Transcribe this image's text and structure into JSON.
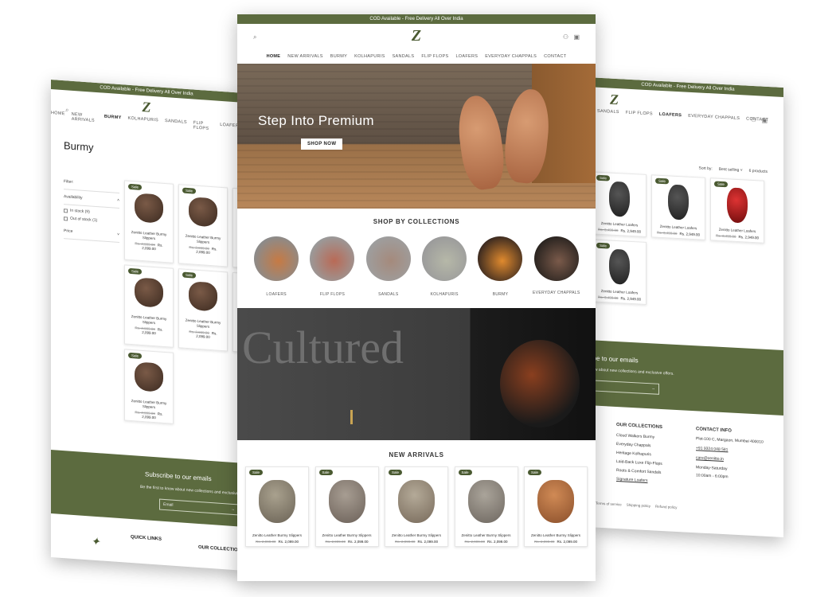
{
  "announcement": "COD Available - Free Delivery All Over India",
  "brand_letter": "Z",
  "nav": [
    "HOME",
    "NEW ARRIVALS",
    "BURMY",
    "KOLHAPURIS",
    "SANDALS",
    "FLIP FLOPS",
    "LOAFERS",
    "EVERYDAY CHAPPALS",
    "CONTACT"
  ],
  "left": {
    "nav": [
      "HOME",
      "NEW ARRIVALS",
      "BURMY",
      "KOLHAPURIS",
      "SANDALS",
      "FLIP FLOPS",
      "LOAFERS"
    ],
    "page_title": "Burmy",
    "filter_heading": "Filter:",
    "availability": "Availability",
    "in_stock": "In stock (9)",
    "out_of_stock": "Out of stock (1)",
    "price": "Price",
    "products": [
      {
        "badge": "Sale",
        "name": "Zenitto Leather Burmy Slippers",
        "old": "Rs. 2,999.00",
        "price": "Rs. 2,099.00"
      },
      {
        "badge": "Sale",
        "name": "Zenitto Leather Burmy Slippers",
        "old": "Rs. 2,999.00",
        "price": "Rs. 2,099.00"
      },
      {
        "badge": "Sale",
        "name": "Zenitto Leather Burmy Slippers",
        "old": "Rs. 2,999.00",
        "price": "Rs. 2,099.00"
      },
      {
        "badge": "Sale",
        "name": "Zenitto Leather Burmy Slippers",
        "old": "Rs. 2,999.00",
        "price": "Rs. 2,099.00"
      },
      {
        "badge": "Sale",
        "name": "Zenitto Leather Burmy Slippers",
        "old": "Rs. 2,999.00",
        "price": "Rs. 2,099.00"
      }
    ],
    "subscribe_title": "Subscribe to our emails",
    "subscribe_text": "Be the first to know about new collections and exclusive offers.",
    "email_placeholder": "Email",
    "quick_links": "QUICK LINKS",
    "our_collections": "OUR COLLECTIONS"
  },
  "center": {
    "hero_title": "Step Into Premium",
    "hero_button": "SHOP NOW",
    "collections_title": "SHOP BY COLLECTIONS",
    "collections": [
      "LOAFERS",
      "FLIP FLOPS",
      "SANDALS",
      "KOLHAPURIS",
      "BURMY",
      "EVERYDAY CHAPPALS"
    ],
    "banner_text": "Cultured",
    "arrivals_title": "NEW ARRIVALS",
    "arrivals": [
      {
        "badge": "Sale",
        "name": "Zenitto Leather Burmy Slippers",
        "old": "Rs. 2,999.00",
        "price": "Rs. 2,099.00"
      },
      {
        "badge": "Sale",
        "name": "Zenitto Leather Burmy Slippers",
        "old": "Rs. 2,999.00",
        "price": "Rs. 2,099.00"
      },
      {
        "badge": "Sale",
        "name": "Zenitto Leather Burmy Slippers",
        "old": "Rs. 2,999.00",
        "price": "Rs. 2,099.00"
      },
      {
        "badge": "Sale",
        "name": "Zenitto Leather Burmy Slippers",
        "old": "Rs. 2,999.00",
        "price": "Rs. 2,099.00"
      },
      {
        "badge": "Sale",
        "name": "Zenitto Leather Burmy Slippers",
        "old": "Rs. 2,999.00",
        "price": "Rs. 2,099.00"
      }
    ]
  },
  "right": {
    "nav": [
      "SANDALS",
      "FLIP FLOPS",
      "LOAFERS",
      "EVERYDAY CHAPPALS",
      "CONTACT"
    ],
    "sort_label": "Sort by:",
    "sort_value": "Best selling",
    "count": "6 products",
    "products": [
      {
        "badge": "Sale",
        "name": "Zenitto Leather Loafers",
        "old": "Rs. 3,499.00",
        "price": "Rs. 2,949.00"
      },
      {
        "badge": "Sale",
        "name": "Zenitto Leather Loafers",
        "old": "Rs. 3,499.00",
        "price": "Rs. 2,949.00"
      },
      {
        "badge": "Sale",
        "name": "Zenitto Leather Loafers",
        "old": "Rs. 3,499.00",
        "price": "Rs. 2,949.00"
      },
      {
        "badge": "Sale",
        "name": "Zenitto Leather Loafers",
        "old": "Rs. 3,499.00",
        "price": "Rs. 2,949.00"
      }
    ],
    "subscribe_title": "Subscribe to our emails",
    "subscribe_text": "Be the first to know about new collections and exclusive offers.",
    "collections_heading": "OUR COLLECTIONS",
    "collections": [
      "Cloud Walkers Burmy",
      "Everyday Chappals",
      "Heritage Kolhapuris",
      "Laid-Back Luxe Flip-Flops",
      "Roots & Comfort Sandals",
      "Signature Loafers"
    ],
    "contact_heading": "CONTACT INFO",
    "address": "Plot-100 C, Margaon, Mumbai 400010",
    "phone": "+91 9324 048 581",
    "email": "care@zenitto.in",
    "hours_days": "Monday-Saturday",
    "hours": "10:00am - 6:00pm",
    "policies": [
      "Terms of service",
      "Shipping policy",
      "Refund policy"
    ]
  },
  "colors": {
    "brand_green": "#5c6b3f",
    "badge_green": "#4a5a31"
  }
}
